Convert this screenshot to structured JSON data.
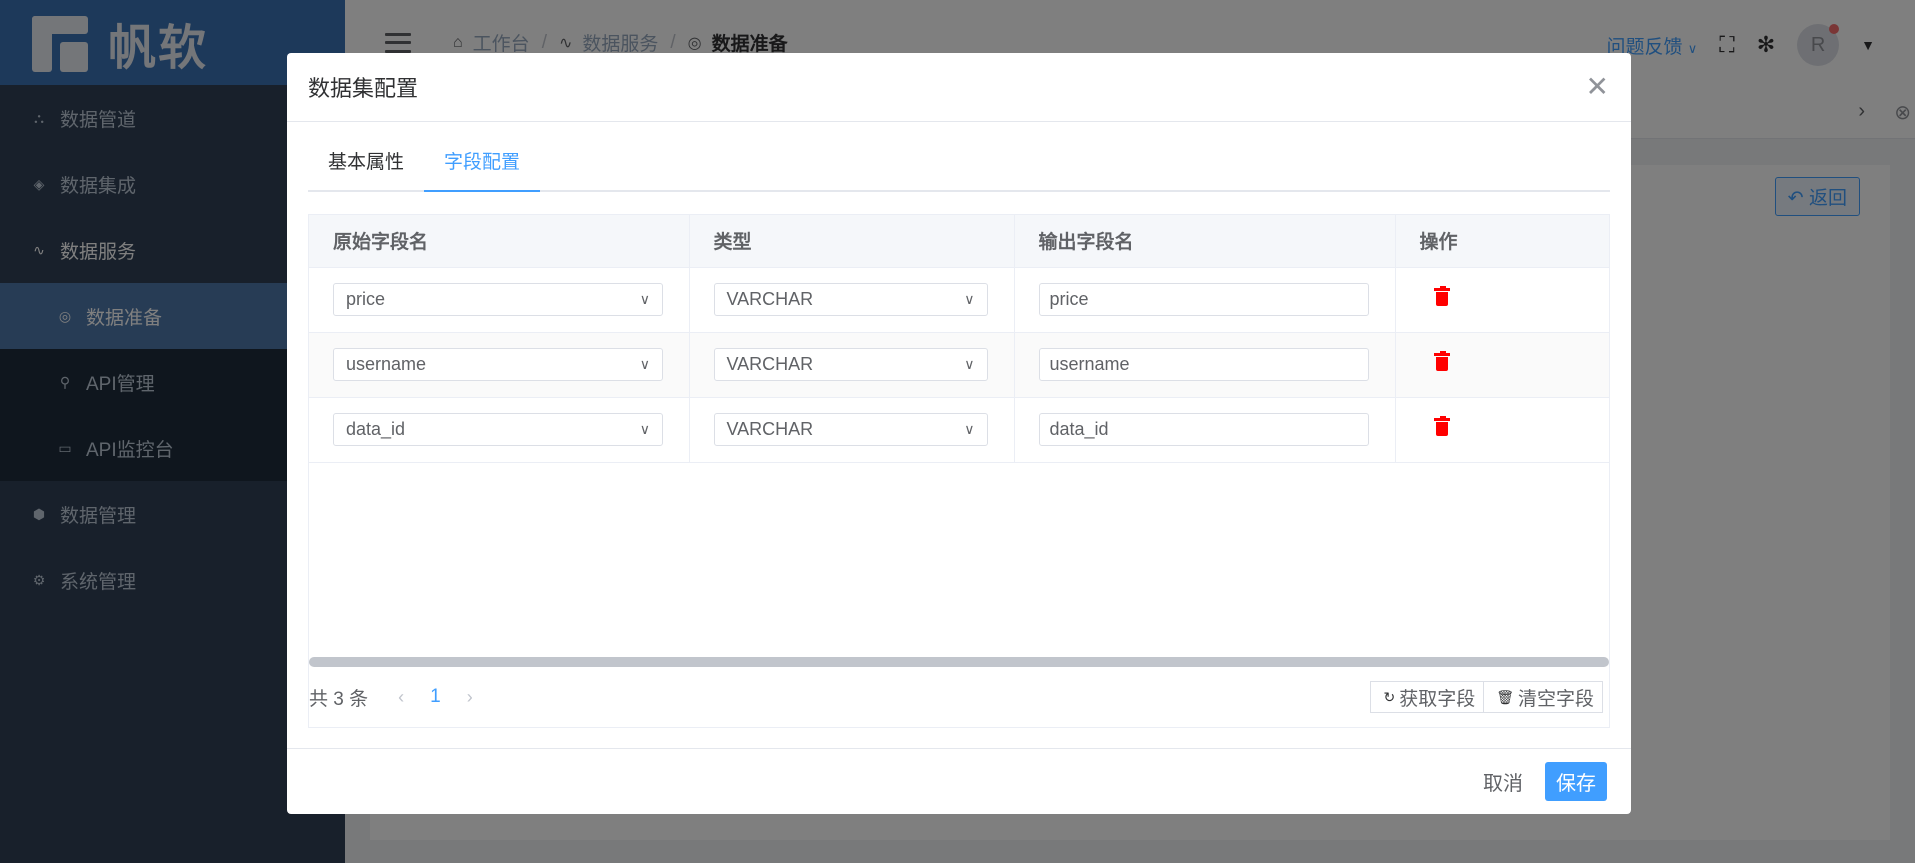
{
  "sidebar": {
    "logo_text": "帆软",
    "items": [
      {
        "label": "数据管道",
        "icon": "pipeline-icon"
      },
      {
        "label": "数据集成",
        "icon": "layers-icon"
      },
      {
        "label": "数据服务",
        "icon": "pulse-icon"
      }
    ],
    "sub_items": [
      {
        "label": "数据准备",
        "icon": "aperture-icon",
        "active": true
      },
      {
        "label": "API管理",
        "icon": "link-icon"
      },
      {
        "label": "API监控台",
        "icon": "monitor-icon"
      }
    ],
    "bottom_items": [
      {
        "label": "数据管理",
        "icon": "cube-icon"
      },
      {
        "label": "系统管理",
        "icon": "gear-icon"
      }
    ]
  },
  "navbar": {
    "breadcrumb": [
      "工作台",
      "数据服务",
      "数据准备"
    ],
    "feedback": "问题反馈",
    "avatar_letter": "R"
  },
  "content": {
    "back_label": "返回"
  },
  "dialog": {
    "title": "数据集配置",
    "tabs": [
      "基本属性",
      "字段配置"
    ],
    "active_tab": 1,
    "columns": [
      "原始字段名",
      "类型",
      "输出字段名",
      "操作"
    ],
    "rows": [
      {
        "source": "price",
        "type": "VARCHAR",
        "output": "price"
      },
      {
        "source": "username",
        "type": "VARCHAR",
        "output": "username"
      },
      {
        "source": "data_id",
        "type": "VARCHAR",
        "output": "data_id"
      }
    ],
    "pager": {
      "total": "共 3 条",
      "current": "1"
    },
    "fetch_label": "获取字段",
    "clear_label": "清空字段",
    "cancel_label": "取消",
    "save_label": "保存"
  },
  "colors": {
    "primary": "#409eff",
    "sidebar_bg": "#304156",
    "danger": "#ff0000"
  }
}
